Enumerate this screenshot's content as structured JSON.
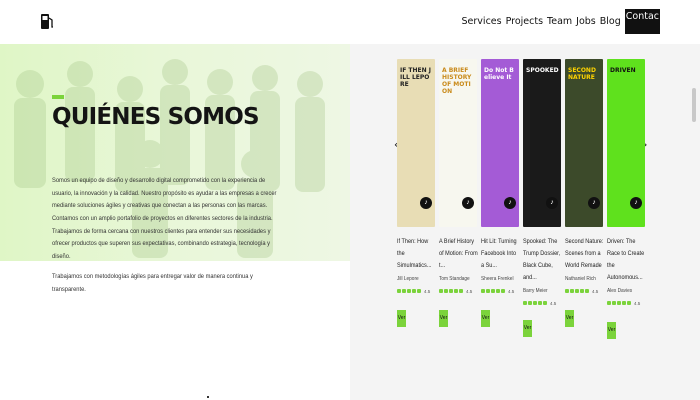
{
  "header": {
    "logo_icon": "fuel-pump-icon",
    "nav": [
      "Services",
      "Projects",
      "Team",
      "Jobs",
      "Blog"
    ],
    "nav_cta": "Contac"
  },
  "hero": {
    "title": "QUIÉNES SOMOS",
    "paragraphs": [
      "Somos un equipo de diseño y desarrollo digital comprometido con la experiencia de usuario, la innovación y la calidad. Nuestro propósito es ayudar a las empresas a crecer mediante soluciones ágiles y creativas que conectan a las personas con las marcas.",
      "Contamos con un amplio portafolio de proyectos en diferentes sectores de la industria. Trabajamos de forma cercana con nuestros clientes para entender sus necesidades y ofrecer productos que superen sus expectativas, combinando estrategia, tecnología y diseño.",
      "Trabajamos con metodologías ágiles para entregar valor de manera continua y transparente."
    ],
    "accent_color": "#7bd33b"
  },
  "carousel": {
    "prev_icon": "chevron-left-icon",
    "next_icon": "chevron-right-icon",
    "books": [
      {
        "cover_text": "IF THEN JILL LEPORE",
        "cover_bg": "#e8ddb5",
        "cover_fg": "#222",
        "title": "If Then: How the Simulmatics...",
        "author": "Jill Lepore",
        "rating": "4.5"
      },
      {
        "cover_text": "A BRIEF HISTORY OF MOTION",
        "cover_bg": "#f7f7ef",
        "cover_fg": "#c98a1a",
        "title": "A Brief History of Motion: From t...",
        "author": "Tom Standage",
        "rating": "4.5"
      },
      {
        "cover_text": "Do Not Believe It",
        "cover_bg": "#a45bd6",
        "cover_fg": "#ffffff",
        "title": "Hit Lit: Turning Facebook Into a Su...",
        "author": "Sheera Frenkel",
        "rating": "4.5"
      },
      {
        "cover_text": "SPOOKED",
        "cover_bg": "#1a1a1a",
        "cover_fg": "#ffffff",
        "title": "Spooked: The Trump Dossier, Black Cube, and...",
        "author": "Barry Meier",
        "rating": "4.5"
      },
      {
        "cover_text": "SECOND NATURE",
        "cover_bg": "#3c4a2a",
        "cover_fg": "#ffd400",
        "title": "Second Nature: Scenes from a World Remade",
        "author": "Nathaniel Rich",
        "rating": "4.5"
      },
      {
        "cover_text": "DRIVEN",
        "cover_bg": "#5fe11d",
        "cover_fg": "#111111",
        "title": "Driven: The Race to Create the Autonomous...",
        "author": "Alex Davies",
        "rating": "4.5"
      }
    ],
    "buy_label": "Ver"
  }
}
